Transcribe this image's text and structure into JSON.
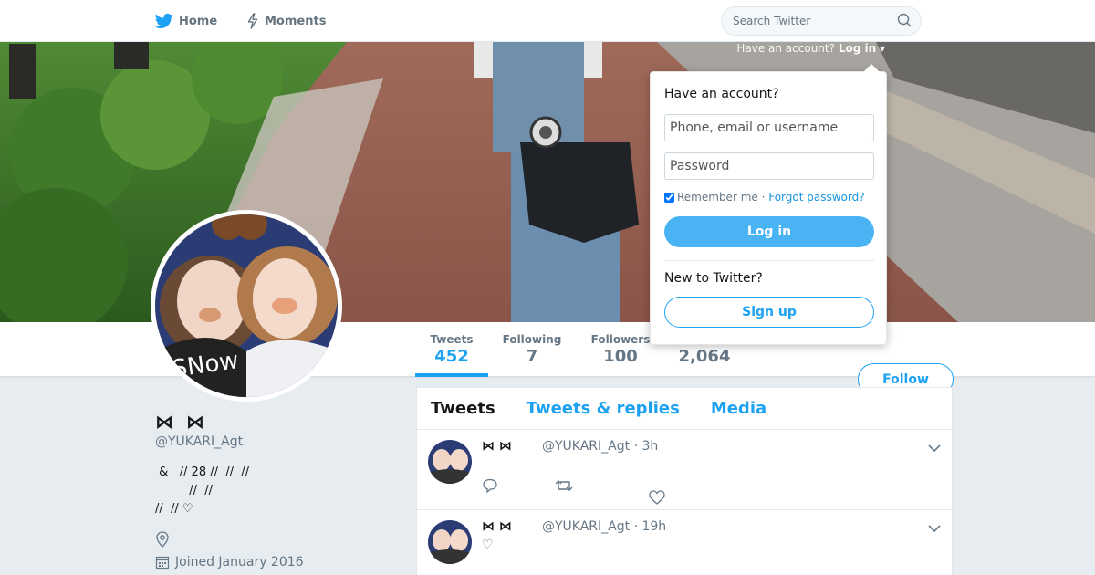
{
  "colors": {
    "accent": "#1da1f2",
    "text_secondary": "#657786",
    "page_bg": "#e6ecf0"
  },
  "nav": {
    "home": {
      "label": "Home",
      "icon": "twitter-bird-icon"
    },
    "moments": {
      "label": "Moments",
      "icon": "lightning-icon"
    }
  },
  "search": {
    "placeholder": "Search Twitter",
    "icon": "search-icon"
  },
  "login_bar": {
    "text": "Have an account?",
    "link": "Log in"
  },
  "profile": {
    "name": "⋈ ︎︎︎︎︎︎ ⋈",
    "handle": "@YUKARI_Agt",
    "bio": " &   // 28 //  //  //\n         //  //\n//  // ♡",
    "joined": "Joined January 2016"
  },
  "stats": {
    "tweets": {
      "label": "Tweets",
      "value": "452"
    },
    "following": {
      "label": "Following",
      "value": "7"
    },
    "followers": {
      "label": "Followers",
      "value": "100"
    },
    "likes": {
      "value": "2,064"
    }
  },
  "follow_button": "Follow",
  "timeline": {
    "tabs": [
      "Tweets",
      "Tweets & replies",
      "Media"
    ],
    "tweets": [
      {
        "name": "⋈  ⋈",
        "meta": "@YUKARI_Agt · 3h",
        "text": ""
      },
      {
        "name": "⋈  ⋈",
        "meta": "@YUKARI_Agt · 19h",
        "text": "♡"
      }
    ]
  },
  "login_dropdown": {
    "title": "Have an account?",
    "username_placeholder": "Phone, email or username",
    "password_placeholder": "Password",
    "remember_label": "Remember me",
    "separator": " · ",
    "forgot_link": "Forgot password?",
    "login_button": "Log in",
    "new_label": "New to Twitter?",
    "signup_button": "Sign up"
  }
}
